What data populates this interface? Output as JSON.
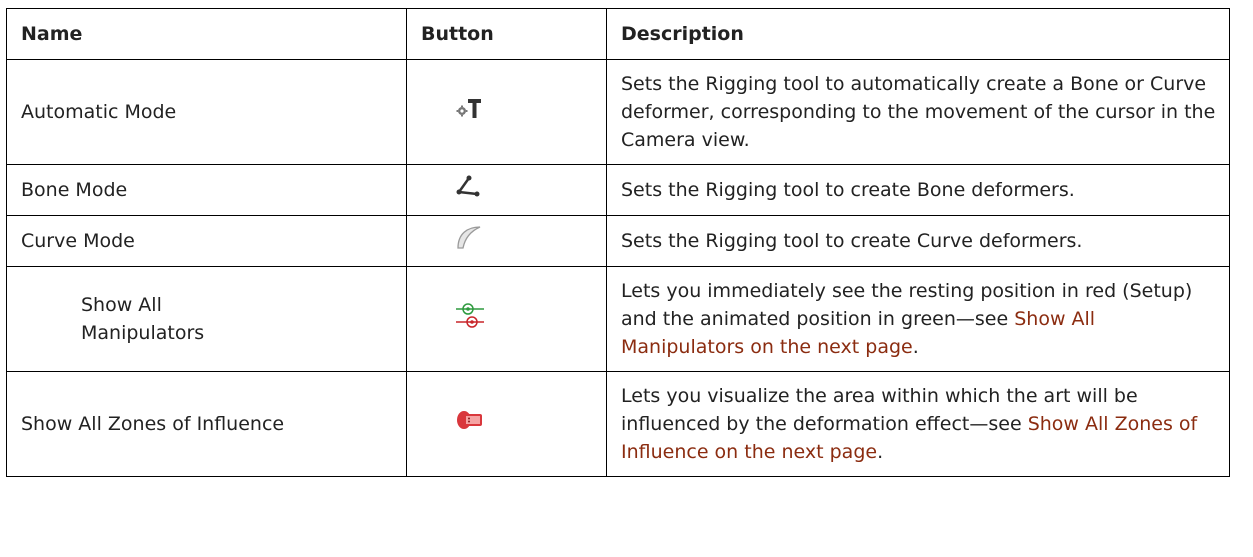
{
  "table": {
    "headers": {
      "name": "Name",
      "button": "Button",
      "description": "Description"
    },
    "rows": [
      {
        "name": "Automatic Mode",
        "icon": "automatic-mode-icon",
        "description": "Sets the Rigging tool to automatically create a Bone or Curve deformer, corresponding to the movement of the cursor in the Camera view."
      },
      {
        "name": "Bone Mode",
        "icon": "bone-mode-icon",
        "description": "Sets the Rigging tool to create Bone deformers."
      },
      {
        "name": "Curve Mode",
        "icon": "curve-mode-icon",
        "description": "Sets the Rigging tool to create Curve deformers."
      },
      {
        "name_line1": "Show All",
        "name_line2": "Manipulators",
        "icon": "show-all-manipulators-icon",
        "description": "Lets you immediately see the resting position in red (Setup) and the animated position in green—see ",
        "link": "Show All Manipulators on the next page",
        "after": "."
      },
      {
        "name": "Show All Zones of Influence",
        "icon": "show-all-zones-icon",
        "description": "Lets you visualize the area within which the art will be influenced by the deformation effect—see ",
        "link": "Show All Zones of Influence on the next page",
        "after": "."
      }
    ]
  },
  "colors": {
    "link": "#8b2c10",
    "border": "#000000"
  }
}
